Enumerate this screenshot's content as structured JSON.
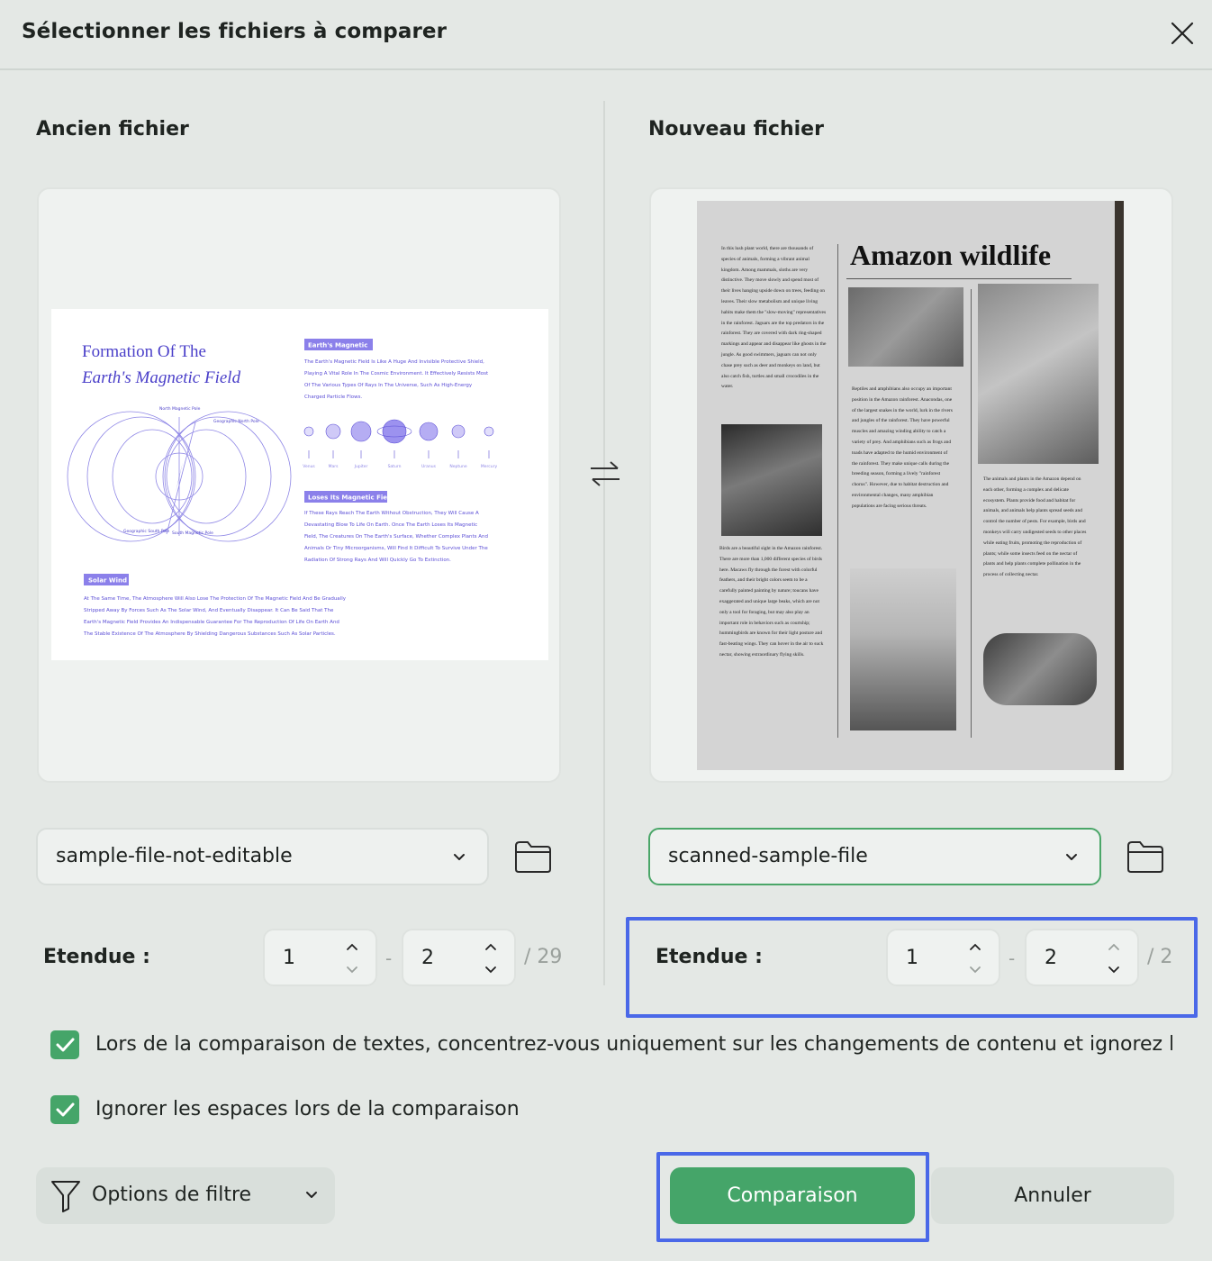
{
  "dialog": {
    "title": "Sélectionner les fichiers à comparer"
  },
  "old": {
    "title": "Ancien fichier",
    "file": "sample-file-not-editable",
    "range_label": "Etendue :",
    "from": "1",
    "to": "2",
    "total": "/ 29",
    "thumb": {
      "title1": "Formation Of The",
      "title2": "Earth's Magnetic Field",
      "tag1": "Earth's Magnetic",
      "tag1_lines": [
        "The Earth's Magnetic Field Is Like A Huge And Invisible Protective Shield,",
        "Playing A Vital Role In The Cosmic Environment. It Effectively Resists Most",
        "Of The Various Types Of Rays In The Universe, Such As High-Energy",
        "Charged Particle Flows."
      ],
      "tag2": "Loses Its Magnetic Field",
      "tag2_lines": [
        "If These Rays Reach The Earth Without Obstruction, They Will Cause A",
        "Devastating Blow To Life On Earth. Once The Earth Loses Its Magnetic",
        "Field, The Creatures On The Earth's Surface, Whether Complex Plants And",
        "Animals Or Tiny Microorganisms, Will Find It Difficult To Survive Under The",
        "Radiation Of Strong Rays And Will Quickly Go To Extinction."
      ],
      "tag3": "Solar Wind",
      "tag3_lines": [
        "At The Same Time, The Atmosphere Will Also Lose The Protection Of The Magnetic Field And Be Gradually",
        "Stripped Away By Forces Such As The Solar Wind, And Eventually Disappear. It Can Be Said That The",
        "Earth's Magnetic Field Provides An Indispensable Guarantee For The Reproduction Of Life On Earth And",
        "The Stable Existence Of The Atmosphere By Shielding Dangerous Substances Such As Solar Particles."
      ],
      "planets": [
        "Venus",
        "Mars",
        "Jupiter",
        "Saturn",
        "Uranus",
        "Neptune",
        "Mercury"
      ],
      "poles": {
        "north_mag": "North Magnetic Pole",
        "north_geo": "Geographic North Pole",
        "south_geo": "Geographic South Pole",
        "south_mag": "South Magnetic Pole"
      }
    }
  },
  "new": {
    "title": "Nouveau fichier",
    "file": "scanned-sample-file",
    "range_label": "Etendue :",
    "from": "1",
    "to": "2",
    "total": "/ 2",
    "thumb": {
      "headline": "Amazon wildlife",
      "col1_top": "In this lush plant world, there are thousands of species of animals, forming a vibrant animal kingdom. Among mammals, sloths are very distinctive. They move slowly and spend most of their lives hanging upside down on trees, feeding on leaves. Their slow metabolism and unique living habits make them the \"slow-moving\" representatives in the rainforest. Jaguars are the top predators in the rainforest. They are covered with dark ring-shaped markings and appear and disappear like ghosts in the jungle. As good swimmers, jaguars can not only chase prey such as deer and monkeys on land, but also catch fish, turtles and small crocodiles in the water.",
      "col1_bottom": "Birds are a beautiful sight in the Amazon rainforest. There are more than 1,000 different species of birds here. Macaws fly through the forest with colorful feathers, and their bright colors seem to be a carefully painted painting by nature; toucans have exaggerated and unique large beaks, which are not only a tool for foraging, but may also play an important role in behaviors such as courtship; hummingbirds are known for their light posture and fast-beating wings. They can hover in the air to suck nectar, showing extraordinary flying skills.",
      "col2": "Reptiles and amphibians also occupy an important position in the Amazon rainforest. Anacondas, one of the largest snakes in the world, lurk in the rivers and jungles of the rainforest. They have powerful muscles and amazing winding ability to catch a variety of prey. And amphibians such as frogs and toads have adapted to the humid environment of the rainforest. They make unique calls during the breeding season, forming a lively \"rainforest chorus\". However, due to habitat destruction and environmental changes, many amphibian populations are facing serious threats.",
      "col3": "The animals and plants in the Amazon depend on each other, forming a complex and delicate ecosystem. Plants provide food and habitat for animals, and animals help plants spread seeds and control the number of pests. For example, birds and monkeys will carry undigested seeds to other places while eating fruits, promoting the reproduction of plants; while some insects feed on the nectar of plants and help plants complete pollination in the process of collecting nectar."
    }
  },
  "options": {
    "opt1": "Lors de la comparaison de textes, concentrez-vous uniquement sur les changements de contenu et ignorez les attri",
    "opt2": "Ignorer les espaces lors de la comparaison",
    "filter": "Options de filtre"
  },
  "actions": {
    "compare": "Comparaison",
    "cancel": "Annuler"
  },
  "colors": {
    "accent": "#45a569",
    "highlight": "#4a68e8",
    "doc_purple": "#5b4ed6"
  }
}
